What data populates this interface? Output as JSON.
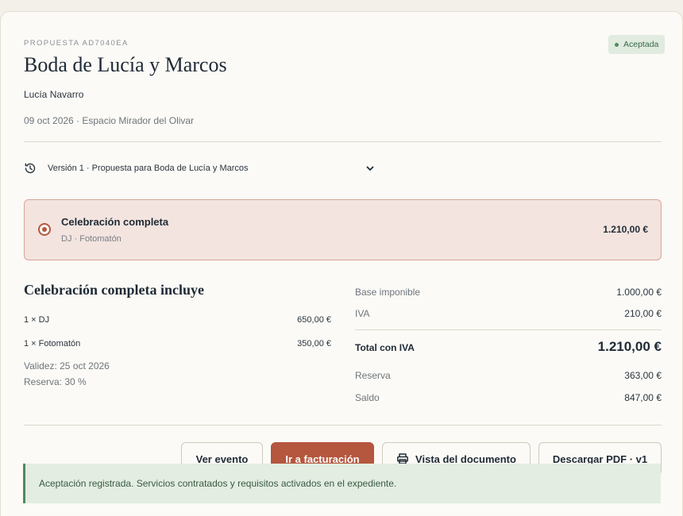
{
  "proposal": {
    "eyebrow": "PROPUESTA AD7040EA",
    "status": "Aceptada",
    "title": "Boda de Lucía y Marcos",
    "client": "Lucía Navarro",
    "event_meta": "09 oct 2026 · Espacio Mirador del Olivar"
  },
  "version_selector": {
    "label": "Versión 1 · Propuesta para Boda de Lucía y Marcos"
  },
  "option": {
    "title": "Celebración completa",
    "subtitle": "DJ · Fotomatón",
    "price": "1.210,00 €",
    "selected": true
  },
  "includes": {
    "title": "Celebración completa incluye",
    "items": [
      {
        "label": "1 × DJ",
        "price": "650,00 €"
      },
      {
        "label": "1 × Fotomatón",
        "price": "350,00 €"
      }
    ],
    "validity": "Validez: 25 oct 2026",
    "deposit": "Reserva: 30 %"
  },
  "summary": {
    "base_label": "Base imponible",
    "base_value": "1.000,00 €",
    "iva_label": "IVA",
    "iva_value": "210,00 €",
    "total_label": "Total con IVA",
    "total_value": "1.210,00 €",
    "reserva_label": "Reserva",
    "reserva_value": "363,00 €",
    "saldo_label": "Saldo",
    "saldo_value": "847,00 €"
  },
  "actions": {
    "view_event": "Ver evento",
    "go_billing": "Ir a facturación",
    "view_document": "Vista del documento",
    "download_pdf": "Descargar PDF · v1"
  },
  "alert": {
    "message": "Aceptación registrada. Servicios contratados y requisitos activados en el expediente."
  },
  "colors": {
    "accent": "#b5563e",
    "success": "#4f8a5f",
    "option_bg": "#f3e4df",
    "alert_bg": "#e3ede2"
  },
  "icons": {
    "version": "history-icon",
    "dropdown": "chevron-down-icon",
    "document": "printer-icon"
  }
}
